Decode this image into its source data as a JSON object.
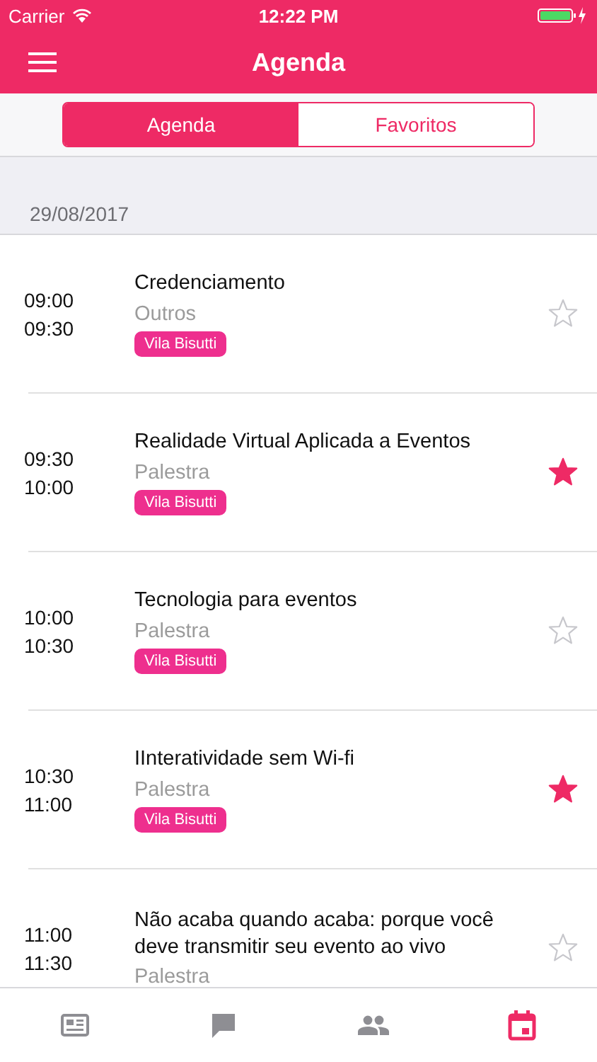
{
  "status_bar": {
    "carrier": "Carrier",
    "time": "12:22 PM"
  },
  "nav": {
    "title": "Agenda"
  },
  "segments": [
    {
      "label": "Agenda",
      "selected": true
    },
    {
      "label": "Favoritos",
      "selected": false
    }
  ],
  "date": "29/08/2017",
  "sessions": [
    {
      "start": "09:00",
      "end": "09:30",
      "title": "Credenciamento",
      "type": "Outros",
      "tag": "Vila Bisutti",
      "favorite": false
    },
    {
      "start": "09:30",
      "end": "10:00",
      "title": "Realidade Virtual Aplicada a Eventos",
      "type": "Palestra",
      "tag": "Vila Bisutti",
      "favorite": true
    },
    {
      "start": "10:00",
      "end": "10:30",
      "title": "Tecnologia para eventos",
      "type": "Palestra",
      "tag": "Vila Bisutti",
      "favorite": false
    },
    {
      "start": "10:30",
      "end": "11:00",
      "title": "IInteratividade sem Wi-fi",
      "type": "Palestra",
      "tag": "Vila Bisutti",
      "favorite": true
    },
    {
      "start": "11:00",
      "end": "11:30",
      "title": "Não acaba quando acaba: porque você deve transmitir seu evento ao vivo",
      "type": "Palestra",
      "favorite": false
    }
  ],
  "tab_bar": [
    {
      "kind": "news",
      "selected": false
    },
    {
      "kind": "chat",
      "selected": false
    },
    {
      "kind": "people",
      "selected": false
    },
    {
      "kind": "calendar",
      "selected": true
    }
  ]
}
